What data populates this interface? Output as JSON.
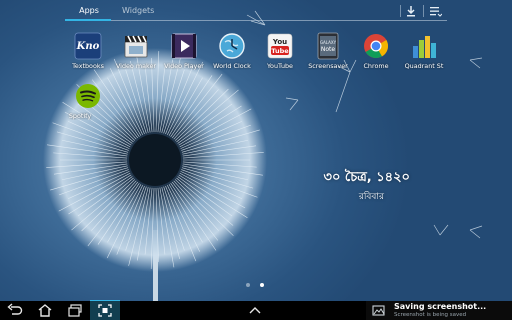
{
  "tabs": {
    "apps": "Apps",
    "widgets": "Widgets"
  },
  "top_icons": {
    "download": "download-icon",
    "menu": "overflow-menu-icon"
  },
  "apps": [
    {
      "label": "Textbooks",
      "icon": "textbooks-icon"
    },
    {
      "label": "Video maker",
      "icon": "clapperboard-icon"
    },
    {
      "label": "Video Player",
      "icon": "play-icon"
    },
    {
      "label": "World Clock",
      "icon": "globe-clock-icon"
    },
    {
      "label": "YouTube",
      "icon": "youtube-icon"
    },
    {
      "label": "Screensaver",
      "icon": "galaxy-note-icon"
    },
    {
      "label": "Chrome",
      "icon": "chrome-icon"
    },
    {
      "label": "Quadrant St",
      "icon": "bar-chart-icon"
    },
    {
      "label": "Spotify",
      "icon": "spotify-icon"
    }
  ],
  "icon_text": {
    "textbooks": "Kno",
    "youtube_top": "You",
    "youtube_bottom": "Tube",
    "galaxy_top": "GALAXY",
    "galaxy_bottom": "Note"
  },
  "clock": {
    "date": "৩০ চৈত্র, ১৪২০",
    "weekday": "রবিবার"
  },
  "page_indicator": {
    "pages": 2,
    "current": 2
  },
  "nav": {
    "back": "back-icon",
    "home": "home-icon",
    "recents": "recent-apps-icon",
    "screenshot": "screenshot-icon",
    "up": "chevron-up-icon"
  },
  "notification": {
    "title": "Saving screenshot...",
    "subtitle": "Screenshot is being saved"
  },
  "colors": {
    "accent": "#33b5e5",
    "wallpaper": "#2a5480",
    "navbar": "#000000"
  }
}
